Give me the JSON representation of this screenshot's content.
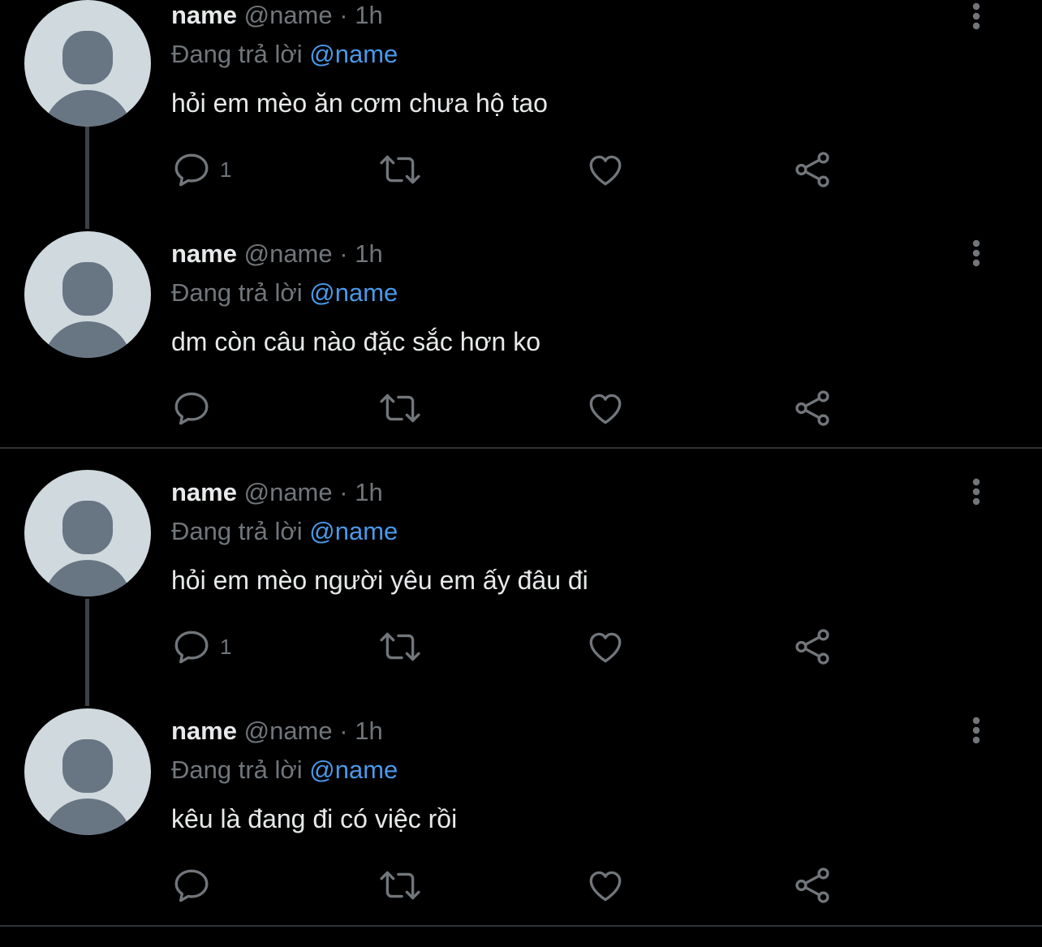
{
  "colors": {
    "background": "#000000",
    "primary_text": "#e7e9ea",
    "secondary_text": "#71767b",
    "mention": "#4a99e9",
    "avatar_bg": "#cfd9de",
    "avatar_silhouette": "#687684",
    "thread_line": "#3e4144",
    "divider": "#2f3336"
  },
  "icons": {
    "reply": "speech-bubble-icon",
    "retweet": "retweet-arrows-icon",
    "like": "heart-icon",
    "share": "share-nodes-icon",
    "more": "vertical-ellipsis-icon"
  },
  "tweets": [
    {
      "display_name": "name",
      "handle": "@name",
      "separator": "·",
      "time": "1h",
      "replying_label": "Đang trả lời",
      "replying_to": "@name",
      "text": "hỏi em mèo ăn cơm chưa hộ tao",
      "reply_count": "1"
    },
    {
      "display_name": "name",
      "handle": "@name",
      "separator": "·",
      "time": "1h",
      "replying_label": "Đang trả lời",
      "replying_to": "@name",
      "text": "dm còn câu nào đặc sắc hơn ko",
      "reply_count": ""
    },
    {
      "display_name": "name",
      "handle": "@name",
      "separator": "·",
      "time": "1h",
      "replying_label": "Đang trả lời",
      "replying_to": "@name",
      "text": "hỏi em mèo người yêu em ấy đâu đi",
      "reply_count": "1"
    },
    {
      "display_name": "name",
      "handle": "@name",
      "separator": "·",
      "time": "1h",
      "replying_label": "Đang trả lời",
      "replying_to": "@name",
      "text": "kêu là đang đi có việc rồi",
      "reply_count": ""
    }
  ]
}
